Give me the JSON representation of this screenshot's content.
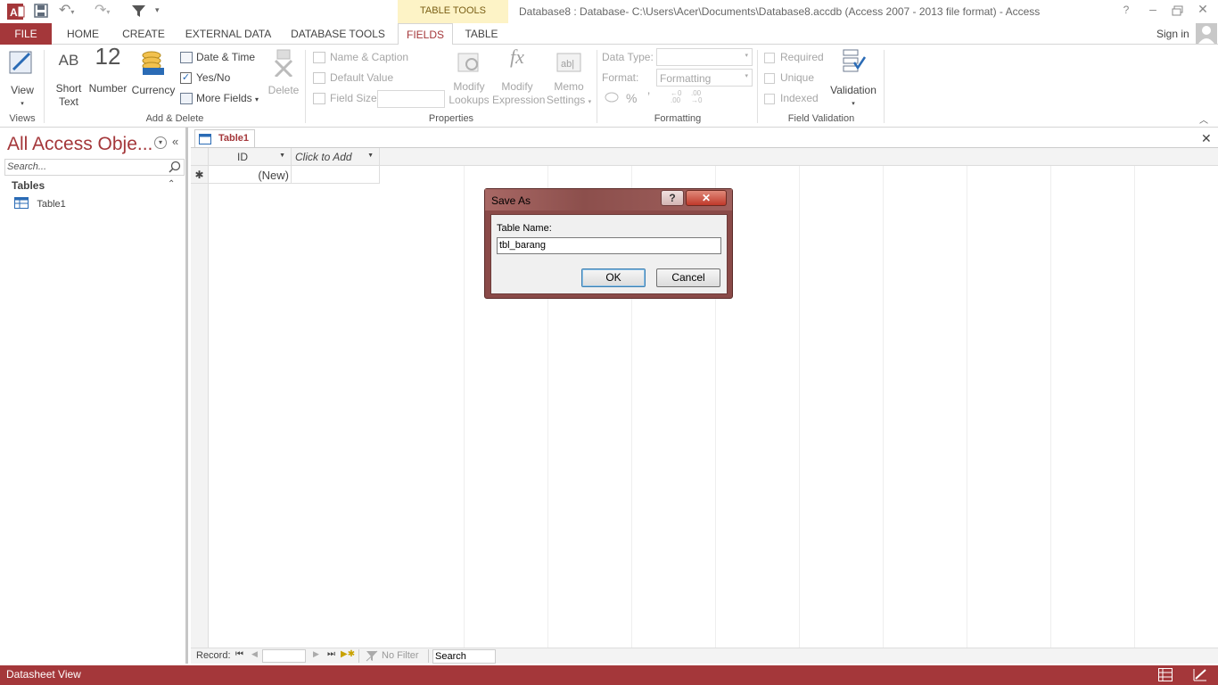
{
  "titlebar": {
    "title": "Database8 : Database- C:\\Users\\Acer\\Documents\\Database8.accdb (Access 2007 - 2013 file format) - Access",
    "context_tab_group": "TABLE TOOLS",
    "help": "?",
    "sign_in": "Sign in"
  },
  "tabs": {
    "file": "FILE",
    "home": "HOME",
    "create": "CREATE",
    "external": "EXTERNAL DATA",
    "dbtools": "DATABASE TOOLS",
    "fields": "FIELDS",
    "table": "TABLE"
  },
  "ribbon": {
    "views": {
      "view": "View",
      "group": "Views"
    },
    "add_delete": {
      "short_text_icon": "AB",
      "short_text_1": "Short",
      "short_text_2": "Text",
      "number_icon": "12",
      "number": "Number",
      "currency": "Currency",
      "date_time": "Date & Time",
      "yes_no": "Yes/No",
      "more_fields": "More Fields",
      "delete": "Delete",
      "group": "Add & Delete"
    },
    "properties": {
      "name_caption": "Name & Caption",
      "default_value": "Default Value",
      "field_size": "Field Size",
      "modify_lookups_1": "Modify",
      "modify_lookups_2": "Lookups",
      "modify_expression_1": "Modify",
      "modify_expression_2": "Expression",
      "memo_settings_1": "Memo",
      "memo_settings_2": "Settings",
      "group": "Properties"
    },
    "formatting": {
      "data_type": "Data Type:",
      "data_type_value": "",
      "format": "Format:",
      "format_value": "Formatting",
      "percent": "%",
      "comma": "’",
      "group": "Formatting"
    },
    "validation": {
      "required": "Required",
      "unique": "Unique",
      "indexed": "Indexed",
      "validation": "Validation",
      "group": "Field Validation"
    }
  },
  "nav": {
    "title": "All Access Obje...",
    "search_placeholder": "Search...",
    "section": "Tables",
    "items": [
      {
        "label": "Table1"
      }
    ]
  },
  "document": {
    "tab": "Table1",
    "columns": [
      {
        "label": "ID"
      },
      {
        "label": "Click to Add"
      }
    ],
    "new_row_marker": "✱",
    "new_row_value": "(New)"
  },
  "recordnav": {
    "label": "Record:",
    "position": "",
    "no_filter": "No Filter",
    "search": "Search"
  },
  "status": {
    "text": "Datasheet View"
  },
  "dialog": {
    "title": "Save As",
    "field_label": "Table Name:",
    "field_value": "tbl_barang",
    "ok": "OK",
    "cancel": "Cancel"
  },
  "colors": {
    "accent": "#a4373a",
    "context_tab": "#fdf3c6"
  }
}
